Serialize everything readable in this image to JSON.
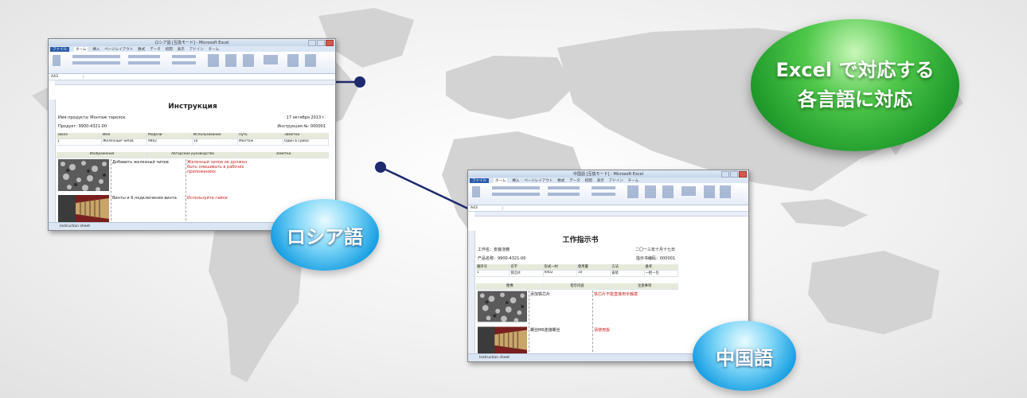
{
  "headline": {
    "line1": "Excel で対応する",
    "line2": "各言語に対応"
  },
  "bubbles": {
    "russian": "ロシア語",
    "chinese": "中国語"
  },
  "excel_ru": {
    "window_title": "ロシア語 [互換モード] - Microsoft Excel",
    "tabs": [
      "ファイル",
      "ホーム",
      "挿入",
      "ページレイアウト",
      "数式",
      "データ",
      "校閲",
      "表示",
      "アドイン",
      "チーム"
    ],
    "name_box": "A43",
    "sheet_title": "Инструкция",
    "project": "Имя продукта: Монтаж тарелок",
    "date": "17 октября 2013 г.",
    "product": "Продукт: 9900-4321-00",
    "instr_no": "Инструкция №: 000001",
    "table_header": [
      "Заказ",
      "Имя",
      "Модели",
      "Использование",
      "Путь",
      "Заметки"
    ],
    "table_row": [
      "1",
      "Железный чипов",
      "9902",
      "10",
      "Монтаж",
      "Один в сумки"
    ],
    "section_header": [
      "Изображения",
      "Авторские руководства",
      "Заметки"
    ],
    "step1_text": "Добавить железный чипов",
    "step1_note": "Железный чипов не должен быть смешивать в рабочих приложениях",
    "step2_text": "Винты и 6 подключения винта",
    "step2_note": "Используйте гайки",
    "sheet_tab": "Instruction sheet"
  },
  "excel_cn": {
    "window_title": "中国語 [互換モード] - Microsoft Excel",
    "tabs": [
      "ファイル",
      "ホーム",
      "挿入",
      "ページレイアウト",
      "数式",
      "データ",
      "校閲",
      "表示",
      "アドイン",
      "チーム"
    ],
    "name_box": "A43",
    "sheet_title": "工作指示书",
    "project": "工作名：安装浇铸",
    "date": "二〇一三年十月十七日",
    "product": "产品名称：9900-4321-00",
    "instr_no": "指示书编码：000001",
    "table_header": [
      "顺序号",
      "名字",
      "形式一村",
      "使用量",
      "方法",
      "备考"
    ],
    "table_row": [
      "1",
      "铁芯片",
      "9402",
      "10",
      "安装",
      "一把一包"
    ],
    "section_header": [
      "图像",
      "指示内容",
      "注意事项"
    ],
    "step1_text": "添加铁芯片",
    "step1_note": "铁芯片不能直接用手触摸",
    "step2_text": "螺丝M6连接螺丝",
    "step2_note": "请使用扳",
    "sheet_tab": "Instruction sheet"
  }
}
